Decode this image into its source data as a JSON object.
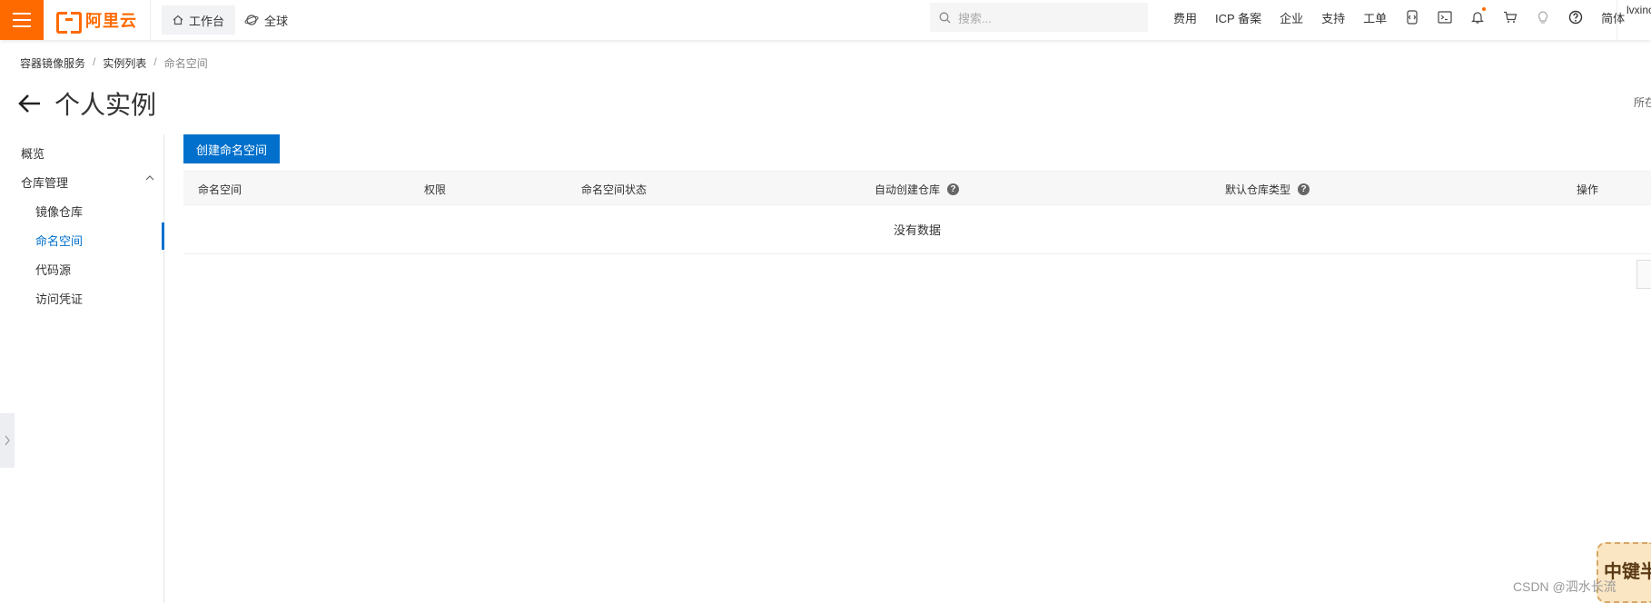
{
  "topbar": {
    "logo_text": "阿里云",
    "workbench": "工作台",
    "region": "全球",
    "search_placeholder": "搜索...",
    "links": [
      "费用",
      "ICP 备案",
      "企业",
      "支持",
      "工单"
    ],
    "lang": "简体",
    "user": "lvxinc",
    "accent": "#ff6a00"
  },
  "breadcrumb": [
    "容器镜像服务",
    "实例列表",
    "命名空间"
  ],
  "page_title": "个人实例",
  "right_edge_text": "所在",
  "sidemenu": {
    "overview": "概览",
    "repo_mgmt": "仓库管理",
    "items": [
      "镜像仓库",
      "命名空间",
      "代码源",
      "访问凭证"
    ],
    "active_index": 1,
    "active_color": "#0070cc"
  },
  "create_button": "创建命名空间",
  "table": {
    "headers": [
      "命名空间",
      "权限",
      "命名空间状态",
      "自动创建仓库",
      "默认仓库类型",
      "操作"
    ],
    "empty_text": "没有数据"
  },
  "watermark": "CSDN @泗水长流",
  "badge_text": "中键半"
}
